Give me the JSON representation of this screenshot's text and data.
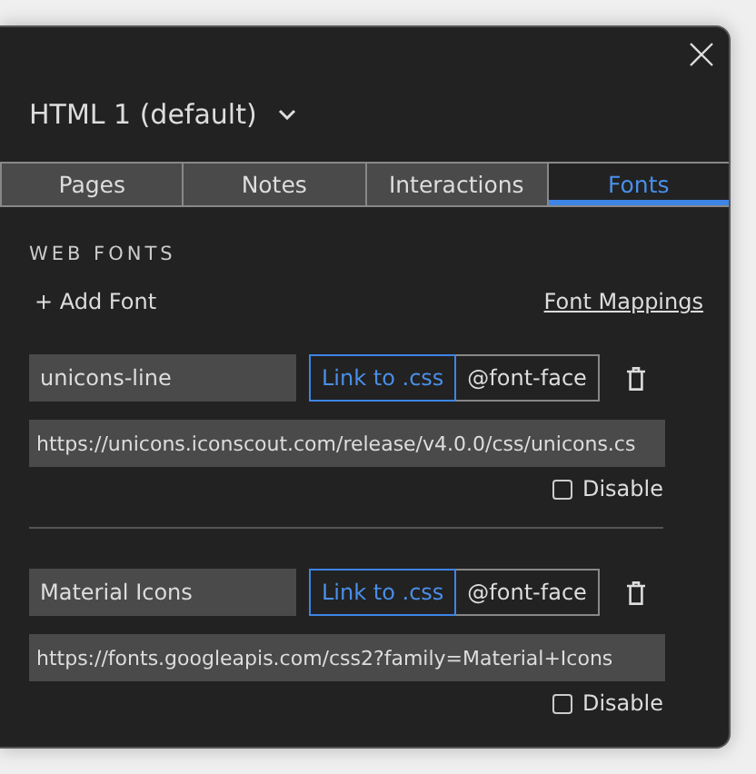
{
  "title": "HTML 1 (default)",
  "tabs": [
    {
      "label": "Pages",
      "selected": false
    },
    {
      "label": "Notes",
      "selected": false
    },
    {
      "label": "Interactions",
      "selected": false
    },
    {
      "label": "Fonts",
      "selected": true
    }
  ],
  "section_heading": "WEB FONTS",
  "add_font": "+ Add Font",
  "font_mappings": "Font Mappings",
  "fonts": [
    {
      "name": "unicons-line",
      "modes": [
        {
          "label": "Link to .css",
          "selected": true
        },
        {
          "label": "@font-face",
          "selected": false
        }
      ],
      "url": "https://unicons.iconscout.com/release/v4.0.0/css/unicons.cs",
      "disable": {
        "label": "Disable",
        "checked": false
      }
    },
    {
      "name": "Material Icons",
      "modes": [
        {
          "label": "Link to .css",
          "selected": true
        },
        {
          "label": "@font-face",
          "selected": false
        }
      ],
      "url": "https://fonts.googleapis.com/css2?family=Material+Icons",
      "disable": {
        "label": "Disable",
        "checked": false
      }
    }
  ]
}
